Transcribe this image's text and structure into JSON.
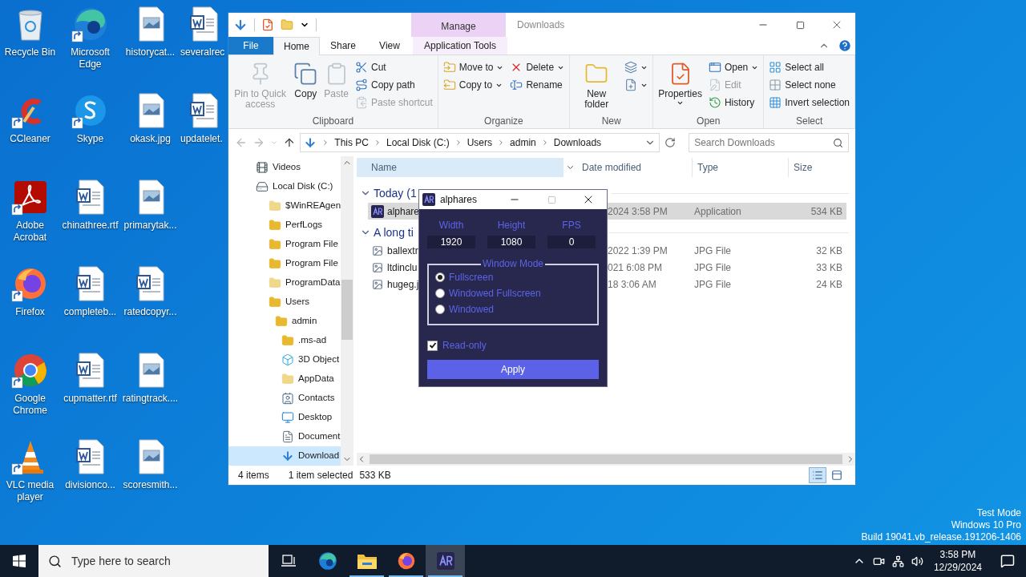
{
  "desktop": {
    "columns": [
      [
        {
          "label": "Recycle Bin",
          "kind": "recycle",
          "shortcut": false
        },
        {
          "label": "CCleaner",
          "kind": "ccleaner",
          "shortcut": true
        },
        {
          "label": "Adobe Acrobat",
          "kind": "acrobat",
          "shortcut": true
        },
        {
          "label": "Firefox",
          "kind": "firefox",
          "shortcut": true
        },
        {
          "label": "Google Chrome",
          "kind": "chrome",
          "shortcut": true
        },
        {
          "label": "VLC media player",
          "kind": "vlc",
          "shortcut": true
        }
      ],
      [
        {
          "label": "Microsoft Edge",
          "kind": "edge",
          "shortcut": true
        },
        {
          "label": "Skype",
          "kind": "skype",
          "shortcut": true
        },
        {
          "label": "chinathree.rtf",
          "kind": "word",
          "shortcut": false
        },
        {
          "label": "completeb...",
          "kind": "word",
          "shortcut": false
        },
        {
          "label": "cupmatter.rtf",
          "kind": "word",
          "shortcut": false
        },
        {
          "label": "divisionco...",
          "kind": "word",
          "shortcut": false
        }
      ],
      [
        {
          "label": "historycat...",
          "kind": "image",
          "shortcut": false
        },
        {
          "label": "okask.jpg",
          "kind": "image",
          "shortcut": false
        },
        {
          "label": "primarytak...",
          "kind": "image",
          "shortcut": false
        },
        {
          "label": "ratedcopyr...",
          "kind": "word",
          "shortcut": false
        },
        {
          "label": "ratingtrack....",
          "kind": "image",
          "shortcut": false
        },
        {
          "label": "scoresmith...",
          "kind": "image",
          "shortcut": false
        }
      ],
      [
        {
          "label": "severalrec",
          "kind": "word",
          "shortcut": false
        },
        {
          "label": "updatelet.",
          "kind": "word",
          "shortcut": false
        }
      ]
    ]
  },
  "system_notice": [
    "Test Mode",
    "Windows 10 Pro",
    "Build 19041.vb_release.191206-1406"
  ],
  "explorer": {
    "title": "Downloads",
    "context_header": "Manage",
    "tabs": [
      {
        "label": "File",
        "kind": "file",
        "selected": false
      },
      {
        "label": "Home",
        "kind": "plain",
        "selected": true
      },
      {
        "label": "Share",
        "kind": "plain",
        "selected": false
      },
      {
        "label": "View",
        "kind": "plain",
        "selected": false
      },
      {
        "label": "Application Tools",
        "kind": "context",
        "selected": false
      }
    ],
    "groups": [
      {
        "label": "Clipboard",
        "columns": [
          [
            {
              "label": "Pin to Quick access",
              "kind": "large",
              "disabled": true,
              "dropdown": false
            }
          ],
          [
            {
              "label": "Copy",
              "kind": "large",
              "disabled": false,
              "dropdown": false
            }
          ],
          [
            {
              "label": "Paste",
              "kind": "large",
              "disabled": true,
              "dropdown": false
            }
          ],
          [
            {
              "label": "Cut",
              "kind": "small",
              "disabled": false,
              "dropdown": false
            },
            {
              "label": "Copy path",
              "kind": "small",
              "disabled": false,
              "dropdown": false
            },
            {
              "label": "Paste shortcut",
              "kind": "small",
              "disabled": true,
              "dropdown": false
            }
          ]
        ]
      },
      {
        "label": "Organize",
        "columns": [
          [
            {
              "label": "Move to",
              "kind": "small",
              "disabled": false,
              "dropdown": true
            },
            {
              "label": "Copy to",
              "kind": "small",
              "disabled": false,
              "dropdown": true
            }
          ],
          [
            {
              "label": "Delete",
              "kind": "small",
              "disabled": false,
              "dropdown": true
            },
            {
              "label": "Rename",
              "kind": "small",
              "disabled": false,
              "dropdown": false
            }
          ]
        ]
      },
      {
        "label": "New",
        "columns": [
          [
            {
              "label": "New folder",
              "kind": "large",
              "disabled": false,
              "dropdown": false
            }
          ],
          [
            {
              "kind": "small",
              "disabled": false,
              "dropdown": true
            },
            {
              "kind": "small",
              "disabled": false,
              "dropdown": true
            }
          ]
        ]
      },
      {
        "label": "Open",
        "columns": [
          [
            {
              "label": "Properties",
              "kind": "large",
              "disabled": false,
              "dropdown": true
            }
          ],
          [
            {
              "label": "Open",
              "kind": "small",
              "disabled": false,
              "dropdown": true
            },
            {
              "label": "Edit",
              "kind": "small",
              "disabled": true,
              "dropdown": false
            },
            {
              "label": "History",
              "kind": "small",
              "disabled": false,
              "dropdown": false
            }
          ]
        ]
      },
      {
        "label": "Select",
        "columns": [
          [
            {
              "label": "Select all",
              "kind": "small",
              "disabled": false,
              "dropdown": false
            },
            {
              "label": "Select none",
              "kind": "small",
              "disabled": false,
              "dropdown": false
            },
            {
              "label": "Invert selection",
              "kind": "small",
              "disabled": false,
              "dropdown": false
            }
          ]
        ]
      }
    ],
    "address": [
      "This PC",
      "Local Disk (C:)",
      "Users",
      "admin",
      "Downloads"
    ],
    "search": {
      "placeholder": "Search Downloads"
    },
    "tree": [
      {
        "label": "Videos",
        "kind": "videos",
        "selected": false
      },
      {
        "label": "Local Disk (C:)",
        "kind": "drive",
        "selected": false,
        "children": [
          {
            "label": "$WinREAgen",
            "kind": "folder-pale",
            "selected": false
          },
          {
            "label": "PerfLogs",
            "kind": "folder",
            "selected": false
          },
          {
            "label": "Program File",
            "kind": "folder",
            "selected": false
          },
          {
            "label": "Program File",
            "kind": "folder",
            "selected": false
          },
          {
            "label": "ProgramData",
            "kind": "folder-pale",
            "selected": false
          },
          {
            "label": "Users",
            "kind": "folder",
            "selected": false,
            "children": [
              {
                "label": "admin",
                "kind": "folder",
                "selected": false,
                "children": [
                  {
                    "label": ".ms-ad",
                    "kind": "folder",
                    "selected": false
                  },
                  {
                    "label": "3D Object",
                    "kind": "cube",
                    "selected": false
                  },
                  {
                    "label": "AppData",
                    "kind": "folder-pale",
                    "selected": false
                  },
                  {
                    "label": "Contacts",
                    "kind": "contacts",
                    "selected": false
                  },
                  {
                    "label": "Desktop",
                    "kind": "desktop",
                    "selected": false
                  },
                  {
                    "label": "Document",
                    "kind": "documents",
                    "selected": false
                  },
                  {
                    "label": "Download",
                    "kind": "downloads",
                    "selected": true
                  }
                ]
              }
            ]
          }
        ]
      }
    ],
    "columns": [
      "Name",
      "Date modified",
      "Type",
      "Size"
    ],
    "file_groups": [
      {
        "label": "Today (1",
        "expanded": true,
        "rows": [
          {
            "name": "alphare",
            "kind": "app",
            "date": "2024 3:58 PM",
            "type": "Application",
            "size": "534 KB",
            "selected": true
          }
        ]
      },
      {
        "label": "A long ti",
        "expanded": true,
        "rows": [
          {
            "name": "ballextr",
            "kind": "image",
            "date": "2022 1:39 PM",
            "type": "JPG File",
            "size": "32 KB",
            "selected": false
          },
          {
            "name": "ltdinclu",
            "kind": "image",
            "date": "021 6:08 PM",
            "type": "JPG File",
            "size": "33 KB",
            "selected": false
          },
          {
            "name": "hugeg.j",
            "kind": "image",
            "date": "18 3:06 AM",
            "type": "JPG File",
            "size": "24 KB",
            "selected": false
          }
        ]
      }
    ],
    "status": {
      "count": "4 items",
      "selection": "1 item selected",
      "size": "533 KB"
    }
  },
  "dialog": {
    "title": "alphares",
    "fields": [
      {
        "label": "Width",
        "value": "1920"
      },
      {
        "label": "Height",
        "value": "1080"
      },
      {
        "label": "FPS",
        "value": "0"
      }
    ],
    "mode": {
      "legend": "Window Mode",
      "options": [
        {
          "label": "Fullscreen",
          "selected": true
        },
        {
          "label": "Windowed Fullscreen",
          "selected": false
        },
        {
          "label": "Windowed",
          "selected": false
        }
      ]
    },
    "readonly": {
      "label": "Read-only",
      "checked": true
    },
    "apply": "Apply"
  },
  "taskbar": {
    "search_placeholder": "Type here to search",
    "apps": [
      {
        "kind": "taskview",
        "running": false,
        "active": false
      },
      {
        "kind": "edge",
        "running": false,
        "active": false
      },
      {
        "kind": "explorer",
        "running": true,
        "active": false
      },
      {
        "kind": "firefox",
        "running": true,
        "active": false
      },
      {
        "kind": "app",
        "running": true,
        "active": true
      }
    ],
    "time": "3:58 PM",
    "date": "12/29/2024"
  }
}
